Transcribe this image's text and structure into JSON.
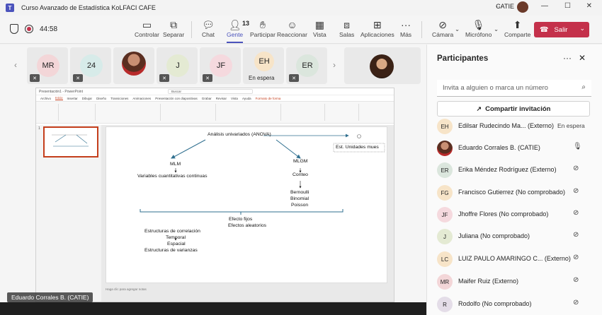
{
  "window": {
    "title": "Curso Avanzado de Estadística KoLFACI CAFE",
    "user": "CATIE"
  },
  "toolbar": {
    "timer": "44:58",
    "buttons": [
      {
        "label": "Controlar",
        "icon": "screen-icon"
      },
      {
        "label": "Separar",
        "icon": "undock-icon"
      },
      {
        "label": "Chat",
        "icon": "chat-icon"
      },
      {
        "label": "Gente",
        "icon": "people-icon",
        "count": "13"
      },
      {
        "label": "Participar",
        "icon": "hand-icon"
      },
      {
        "label": "Reaccionar",
        "icon": "smile-icon"
      },
      {
        "label": "Vista",
        "icon": "view-icon"
      },
      {
        "label": "Salas",
        "icon": "rooms-icon"
      },
      {
        "label": "Aplicaciones",
        "icon": "apps-icon"
      },
      {
        "label": "Más",
        "icon": "more-icon"
      },
      {
        "label": "Cámara",
        "icon": "camera-off-icon"
      },
      {
        "label": "Micrófono",
        "icon": "mic-off-icon"
      },
      {
        "label": "Comparte",
        "icon": "share-icon"
      }
    ],
    "leave_label": "Salir"
  },
  "strip": {
    "tiles": [
      {
        "initials": "MR",
        "color": "#f3d6d8"
      },
      {
        "initials": "24",
        "color": "#d7ebe9"
      },
      {
        "initials": "",
        "color": "#e9e9e9"
      },
      {
        "initials": "J",
        "color": "#e4ead3"
      },
      {
        "initials": "JF",
        "color": "#f5d9de"
      },
      {
        "initials": "EH",
        "color": "#f7e4c8",
        "label": "En espera"
      },
      {
        "initials": "ER",
        "color": "#dbe6dd"
      }
    ]
  },
  "presentation": {
    "app_name": "Presentación1 - PowerPoint",
    "search_placeholder": "Buscar",
    "tabs": [
      "Archivo",
      "Inicio",
      "Insertar",
      "Dibujar",
      "Diseño",
      "Transiciones",
      "Animaciones",
      "Presentación con diapositivas",
      "Grabar",
      "Revisar",
      "Vista",
      "Ayuda",
      "Formato de forma"
    ],
    "slide_number": "1",
    "notes_placeholder": "Haga clic para agregar notas",
    "slide_texts": {
      "anova": "Análisis univariados (ANOVA)",
      "unidades": "Est. Unidades mues",
      "mlm": "MLM",
      "mlm_desc": "Variables cuantitativas continuas",
      "mlgm": "MLGM",
      "conteo": "Conteo",
      "bernoulli": "Bernoulli",
      "binomial": "Binomial",
      "poisson": "Poisson",
      "efectos_fijos": "Efecto fijos",
      "efectos_aleatorios": "Efectos aleatorios",
      "estructuras_corr": "Estructuras de correlación",
      "temporal": "Temporal",
      "espacial": "Espacial",
      "estructuras_var": "Estructuras de varianzas"
    }
  },
  "caption": "Eduardo Corrales B. (CATIE)",
  "panel": {
    "title": "Participantes",
    "invite_placeholder": "Invita a alguien o marca un número",
    "share_label": "Compartir invitación",
    "participants": [
      {
        "initials": "EH",
        "name": "Edilsar Rudecindo Ma... (Externo)",
        "status": "En espera",
        "color": "#f7e4c8",
        "mic": ""
      },
      {
        "initials": "",
        "name": "Eduardo Corrales B. (CATIE)",
        "status": "",
        "color": "photo",
        "mic": "mic-on"
      },
      {
        "initials": "ER",
        "name": "Erika Méndez Rodríguez (Externo)",
        "status": "",
        "color": "#dbe6dd",
        "mic": "mic-off"
      },
      {
        "initials": "FG",
        "name": "Francisco Gutierrez (No comprobado)",
        "status": "",
        "color": "#f7e4c8",
        "mic": "mic-off"
      },
      {
        "initials": "JF",
        "name": "Jhoffre Flores (No comprobado)",
        "status": "",
        "color": "#f5d9de",
        "mic": "mic-off"
      },
      {
        "initials": "J",
        "name": "Juliana (No comprobado)",
        "status": "",
        "color": "#e4ead3",
        "mic": "mic-off"
      },
      {
        "initials": "LC",
        "name": "LUIZ PAULO AMARINGO C... (Externo)",
        "status": "",
        "color": "#f7e4c8",
        "mic": "mic-off"
      },
      {
        "initials": "MR",
        "name": "Maifer Ruiz (Externo)",
        "status": "",
        "color": "#f3d6d8",
        "mic": "mic-off"
      },
      {
        "initials": "R",
        "name": "Rodolfo (No comprobado)",
        "status": "",
        "color": "#e4dde8",
        "mic": "mic-off"
      }
    ]
  }
}
